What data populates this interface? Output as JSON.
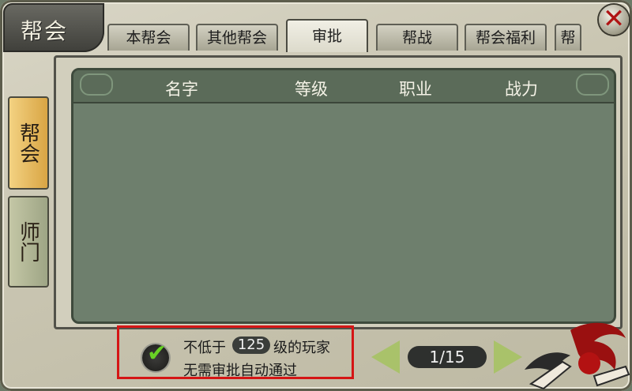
{
  "window": {
    "title": "帮会"
  },
  "tabs": [
    {
      "label": "本帮会"
    },
    {
      "label": "其他帮会"
    },
    {
      "label": "审批",
      "active": true
    },
    {
      "label": "帮战"
    },
    {
      "label": "帮会福利"
    },
    {
      "label": "帮"
    }
  ],
  "side_tabs": [
    {
      "label": "帮会"
    },
    {
      "label": "师门"
    }
  ],
  "table": {
    "columns": [
      "名字",
      "等级",
      "职业",
      "战力"
    ],
    "rows": []
  },
  "auto_approve": {
    "prefix": "不低于",
    "level": "125",
    "suffix": "级的玩家",
    "line2": "无需审批自动通过",
    "checked": true
  },
  "pagination": {
    "label": "1/15"
  },
  "colors": {
    "accent_highlight": "#d51515",
    "check": "#68d125",
    "arrow": "#a9c26a"
  },
  "icons": {
    "close": "close-icon",
    "check": "checkmark-icon",
    "prev": "arrow-left-icon",
    "next": "arrow-right-icon",
    "logo": "game-logo"
  }
}
